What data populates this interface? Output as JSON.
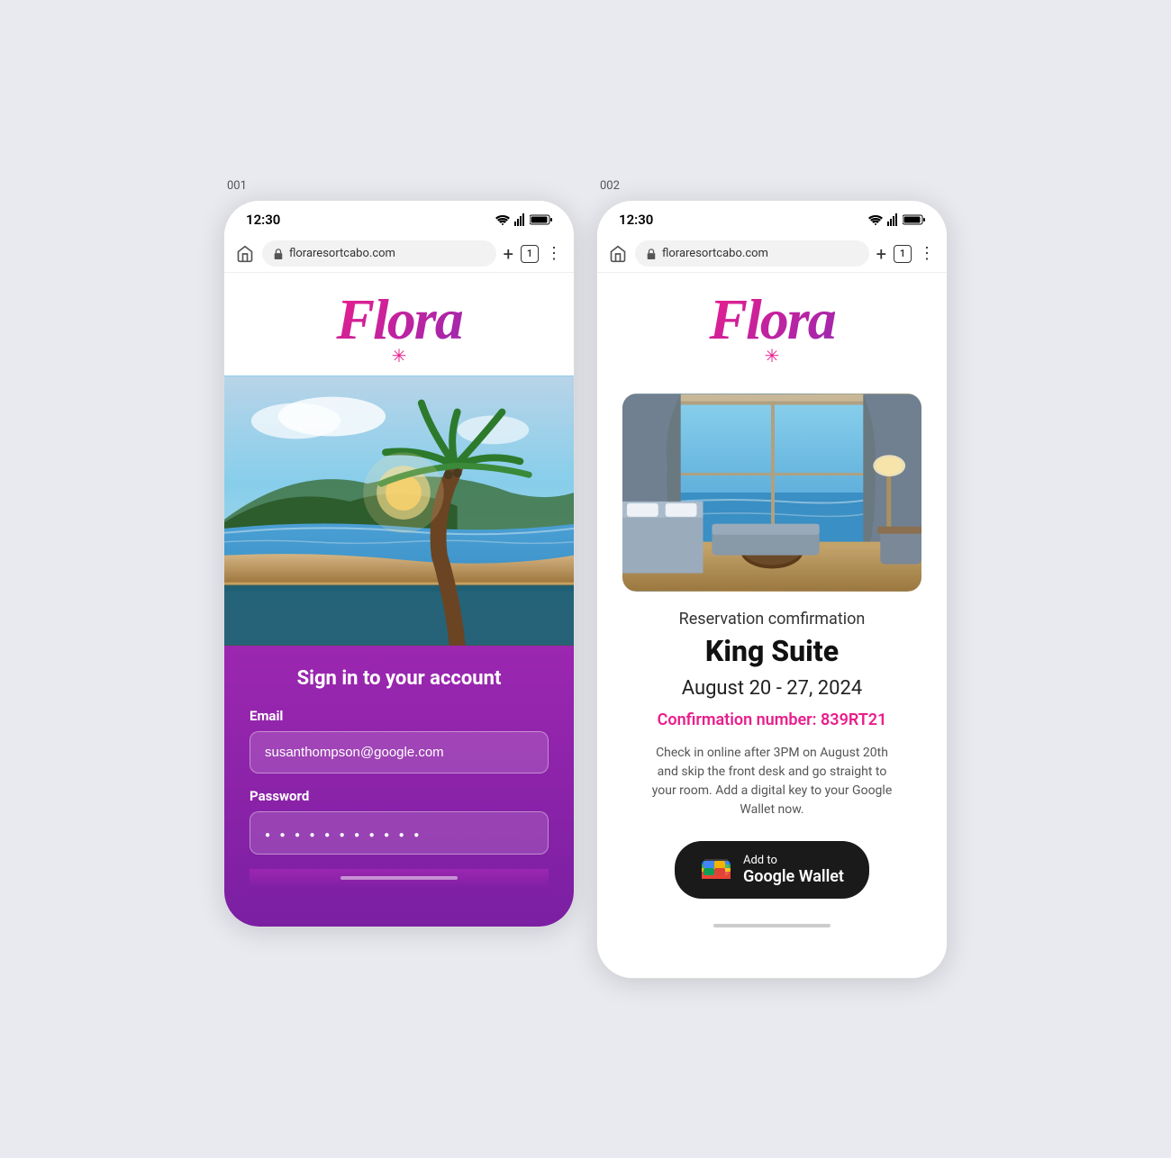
{
  "screens": [
    {
      "number": "001",
      "status": {
        "time": "12:30",
        "url": "floraresortcabo.com"
      },
      "logo": "Flora",
      "asterisk": "✳",
      "signin": {
        "title": "Sign in to your account",
        "email_label": "Email",
        "email_value": "susanthompson@google.com",
        "password_label": "Password",
        "password_value": "● ● ● ● ● ● ● ● ● ● ●"
      }
    },
    {
      "number": "002",
      "status": {
        "time": "12:30",
        "url": "floraresortcabo.com"
      },
      "logo": "Flora",
      "asterisk": "✳",
      "confirmation": {
        "label": "Reservation comfirmation",
        "room_type": "King Suite",
        "dates": "August 20 - 27, 2024",
        "confirmation_number": "Confirmation number: 839RT21",
        "checkin_text": "Check in online after 3PM on August 20th and skip the front desk and go straight to your room. Add a digital key to your Google Wallet now.",
        "wallet_add_to": "Add to",
        "wallet_name": "Google Wallet"
      }
    }
  ]
}
